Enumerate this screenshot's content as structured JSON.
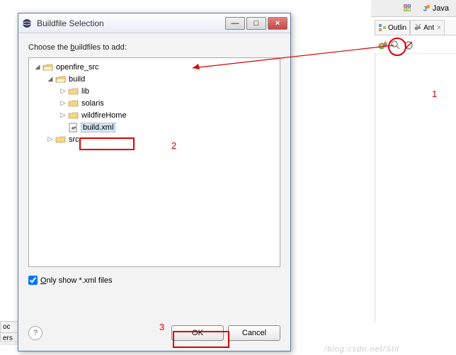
{
  "ide": {
    "perspectives": {
      "other_icon": "open-perspective-icon",
      "java_label": "Java"
    },
    "right_tabs": {
      "outline_label": "Outlin",
      "ant_label": "Ant"
    },
    "left_tabs": {
      "oc_label": "oc",
      "ers_label": "ers"
    },
    "watermark": "/blog.csdn.net/Stil"
  },
  "dialog": {
    "title": "Buildfile Selection",
    "prompt_prefix": "Choose the ",
    "prompt_underlined": "b",
    "prompt_suffix": "uildfiles to add:",
    "tree": {
      "openfire": "openfire_src",
      "build": "build",
      "lib": "lib",
      "solaris": "solaris",
      "wildfireHome": "wildfireHome",
      "buildxml": "build.xml",
      "src": "src"
    },
    "checkbox": {
      "checked": true,
      "label_prefix": "O",
      "label_suffix": "nly show *.xml files"
    },
    "ok": "OK",
    "cancel": "Cancel"
  },
  "annotations": {
    "num1": "1",
    "num2": "2",
    "num3": "3"
  }
}
